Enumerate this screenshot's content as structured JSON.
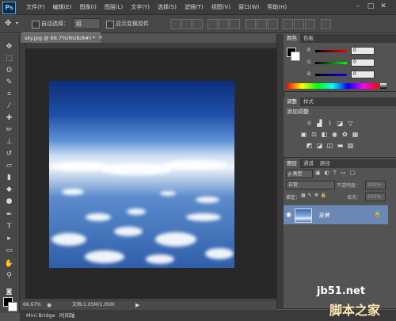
{
  "app": {
    "logo": "Ps",
    "menus": [
      "文件(F)",
      "编辑(E)",
      "图像(I)",
      "图层(L)",
      "文字(Y)",
      "选择(S)",
      "滤镜(T)",
      "视图(V)",
      "窗口(W)",
      "帮助(H)"
    ],
    "window_controls": [
      "–",
      "□",
      "✕"
    ]
  },
  "options_bar": {
    "auto_select_label": "自动选择：",
    "auto_select_value": "组",
    "show_transform_label": "显示变换控件"
  },
  "document": {
    "tab_title": "sky.jpg @ 66.7%(RGB/8#) *",
    "tab_close": "×"
  },
  "status": {
    "zoom": "66.67%",
    "doc_info": "文档:1.05M/1.05M"
  },
  "bottom_tabs": [
    "Mini Bridge",
    "时间轴"
  ],
  "color_panel": {
    "tabs": [
      "颜色",
      "色板"
    ],
    "channels": [
      {
        "label": "R",
        "value": "0"
      },
      {
        "label": "G",
        "value": "0"
      },
      {
        "label": "B",
        "value": "0"
      }
    ]
  },
  "adjustments_panel": {
    "tabs": [
      "调整",
      "样式"
    ],
    "add_label": "添加调整"
  },
  "layers_panel": {
    "tabs": [
      "图层",
      "通道",
      "路径"
    ],
    "filter_label": "ρ 类型",
    "blend_mode": "正常",
    "opacity_label": "不透明度：",
    "opacity_value": "100%",
    "lock_label": "锁定：",
    "fill_label": "填充：",
    "fill_value": "100%",
    "layer_name": "背景"
  },
  "watermark": {
    "line1": "jb51.net",
    "line2": "脚本之家"
  },
  "colors": {
    "accent_selected_layer": "#6b88b4",
    "panel_bg": "#535353"
  }
}
